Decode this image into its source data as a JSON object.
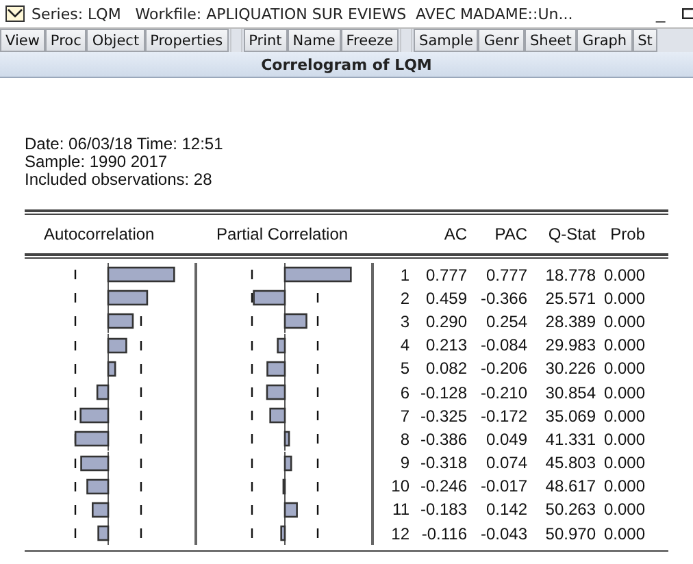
{
  "window": {
    "title": "Series: LQM   Workfile: APLIQUATION SUR EVIEWS  AVEC MADAME::Un...",
    "minimize": "_"
  },
  "toolbar": [
    [
      "View",
      "Proc",
      "Object",
      "Properties"
    ],
    [
      "Print",
      "Name",
      "Freeze"
    ],
    [
      "Sample",
      "Genr",
      "Sheet",
      "Graph",
      "St"
    ]
  ],
  "view_title": "Correlogram of LQM",
  "info": [
    "Date: 06/03/18   Time: 12:51",
    "Sample: 1990 2017",
    "Included observations: 28"
  ],
  "columns": [
    "Autocorrelation",
    "Partial Correlation",
    "AC",
    "PAC",
    "Q-Stat",
    "Prob"
  ],
  "rows": [
    {
      "lag": "1",
      "ac": "0.777",
      "pac": "0.777",
      "q": "18.778",
      "prob": "0.000"
    },
    {
      "lag": "2",
      "ac": "0.459",
      "pac": "-0.366",
      "q": "25.571",
      "prob": "0.000"
    },
    {
      "lag": "3",
      "ac": "0.290",
      "pac": "0.254",
      "q": "28.389",
      "prob": "0.000"
    },
    {
      "lag": "4",
      "ac": "0.213",
      "pac": "-0.084",
      "q": "29.983",
      "prob": "0.000"
    },
    {
      "lag": "5",
      "ac": "0.082",
      "pac": "-0.206",
      "q": "30.226",
      "prob": "0.000"
    },
    {
      "lag": "6",
      "ac": "-0.128",
      "pac": "-0.210",
      "q": "30.854",
      "prob": "0.000"
    },
    {
      "lag": "7",
      "ac": "-0.325",
      "pac": "-0.172",
      "q": "35.069",
      "prob": "0.000"
    },
    {
      "lag": "8",
      "ac": "-0.386",
      "pac": "0.049",
      "q": "41.331",
      "prob": "0.000"
    },
    {
      "lag": "9",
      "ac": "-0.318",
      "pac": "0.074",
      "q": "45.803",
      "prob": "0.000"
    },
    {
      "lag": "10",
      "ac": "-0.246",
      "pac": "-0.017",
      "q": "48.617",
      "prob": "0.000"
    },
    {
      "lag": "11",
      "ac": "-0.183",
      "pac": "0.142",
      "q": "50.263",
      "prob": "0.000"
    },
    {
      "lag": "12",
      "ac": "-0.116",
      "pac": "-0.043",
      "q": "50.970",
      "prob": "0.000"
    }
  ]
}
